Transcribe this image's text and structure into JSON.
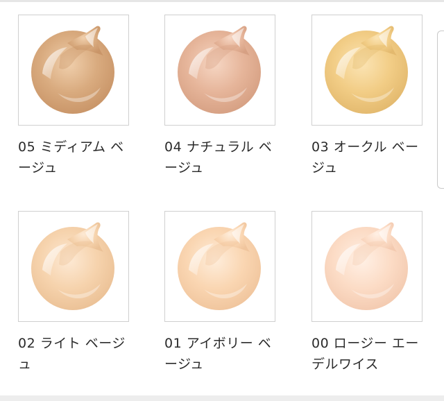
{
  "shades": [
    {
      "label": "05 ミディアム ベージュ",
      "swatch_color": "#d9ab7f",
      "highlight_color": "#f0cfac",
      "shadow_color": "#c99568",
      "swatch_icon": "foundation-swatch-icon"
    },
    {
      "label": "04 ナチュラル ベージュ",
      "swatch_color": "#e6b59a",
      "highlight_color": "#f6d6c3",
      "shadow_color": "#d6a083",
      "swatch_icon": "foundation-swatch-icon"
    },
    {
      "label": "03 オークル ベージュ",
      "swatch_color": "#f2cd86",
      "highlight_color": "#fbe4b4",
      "shadow_color": "#e3b96e",
      "swatch_icon": "foundation-swatch-icon"
    },
    {
      "label": "02 ライト ベージュ",
      "swatch_color": "#f6d3ad",
      "highlight_color": "#fde9d4",
      "shadow_color": "#ebc196",
      "swatch_icon": "foundation-swatch-icon"
    },
    {
      "label": "01 アイボリー ベージュ",
      "swatch_color": "#fad6b2",
      "highlight_color": "#feeddb",
      "shadow_color": "#f0c59d",
      "swatch_icon": "foundation-swatch-icon"
    },
    {
      "label": "00 ロージー エーデルワイス",
      "swatch_color": "#fcdcc6",
      "highlight_color": "#fff0e5",
      "shadow_color": "#f3cab0",
      "swatch_icon": "foundation-swatch-icon"
    }
  ]
}
